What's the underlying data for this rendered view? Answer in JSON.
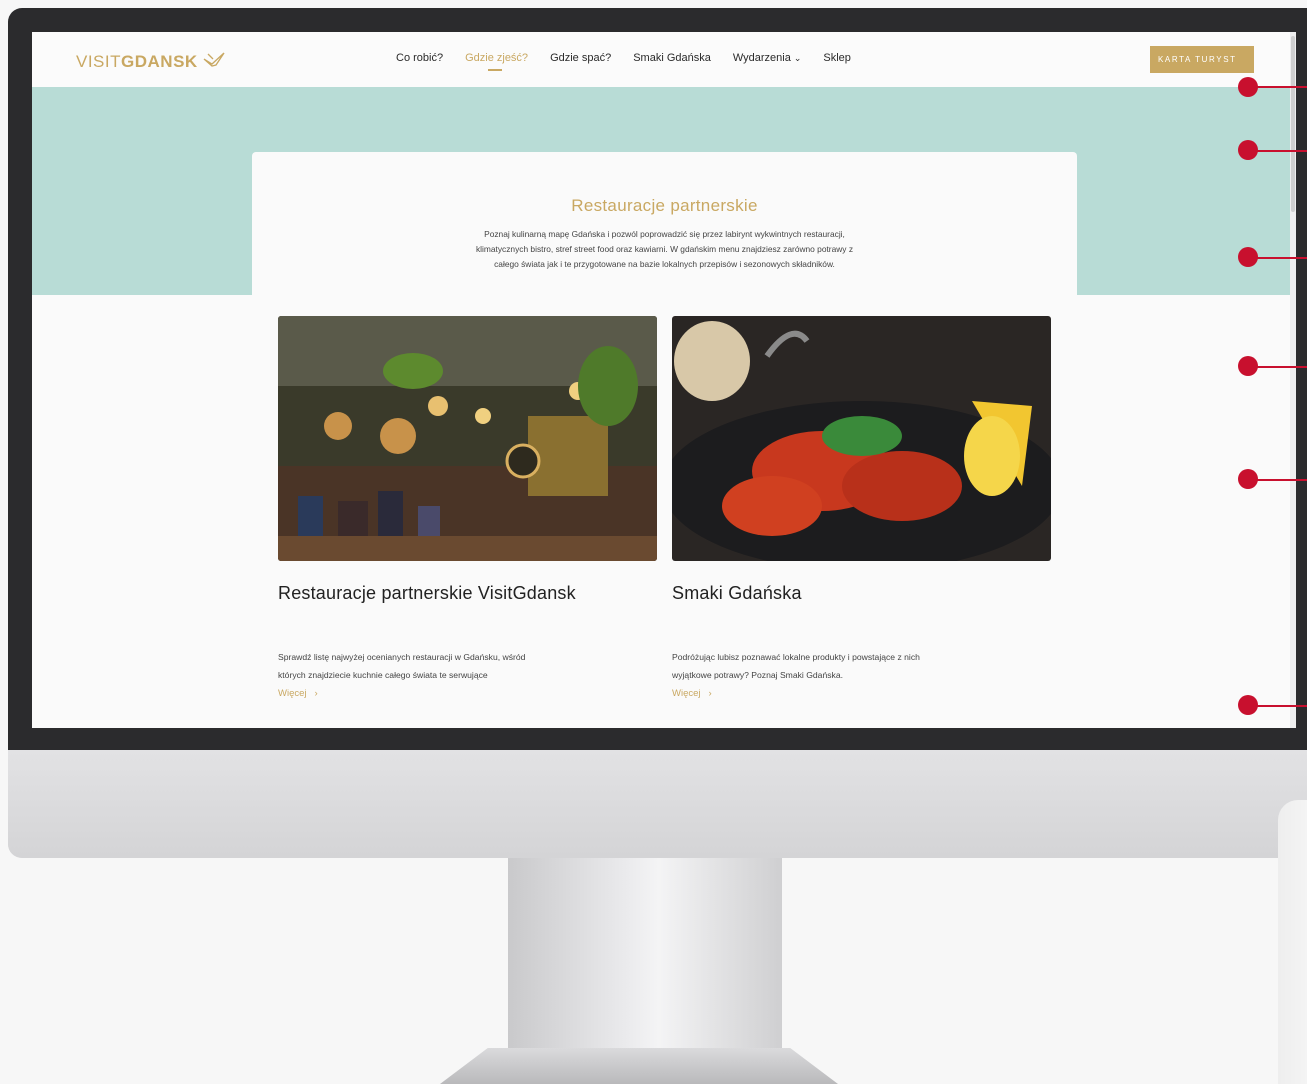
{
  "header": {
    "logo_part1": "VISIT",
    "logo_part2": "GDANSK",
    "logo_icon": "bird-logo-icon",
    "nav": [
      {
        "label": "Co robić?",
        "active": false
      },
      {
        "label": "Gdzie zjeść?",
        "active": true
      },
      {
        "label": "Gdzie spać?",
        "active": false
      },
      {
        "label": "Smaki Gdańska",
        "active": false
      },
      {
        "label": "Wydarzenia",
        "active": false,
        "dropdown": true
      },
      {
        "label": "Sklep",
        "active": false
      }
    ],
    "cta_label": "KARTA TURYST"
  },
  "intro": {
    "title": "Restauracje partnerskie",
    "line1": "Poznaj kulinarną mapę Gdańska i pozwól poprowadzić się przez labirynt wykwintnych restauracji,",
    "line2": "klimatycznych bistro, stref street food oraz kawiarni. W gdańskim menu znajdziesz zarówno potrawy z",
    "line3": "całego świata jak i te przygotowane na bazie lokalnych przepisów i sezonowych składników."
  },
  "cards": [
    {
      "title": "Restauracje partnerskie VisitGdansk",
      "desc1": "Sprawdź listę najwyżej ocenianych restauracji w Gdańsku, wśród",
      "desc2": "których znajdziecie kuchnie całego świata te serwujące",
      "more": "Więcej",
      "image": "restaurant-interior-photo"
    },
    {
      "title": "Smaki Gdańska",
      "desc1": "Podróżując lubisz poznawać lokalne produkty i powstające z nich",
      "desc2": "wyjątkowe potrawy? Poznaj Smaki Gdańska.",
      "more": "Więcej",
      "image": "crayfish-dish-photo"
    }
  ],
  "colors": {
    "accent_gold": "#c9a862",
    "hero_teal": "#b8dcd6",
    "marker_red": "#c8102e"
  },
  "chevron": "⌄",
  "arrow": "›"
}
